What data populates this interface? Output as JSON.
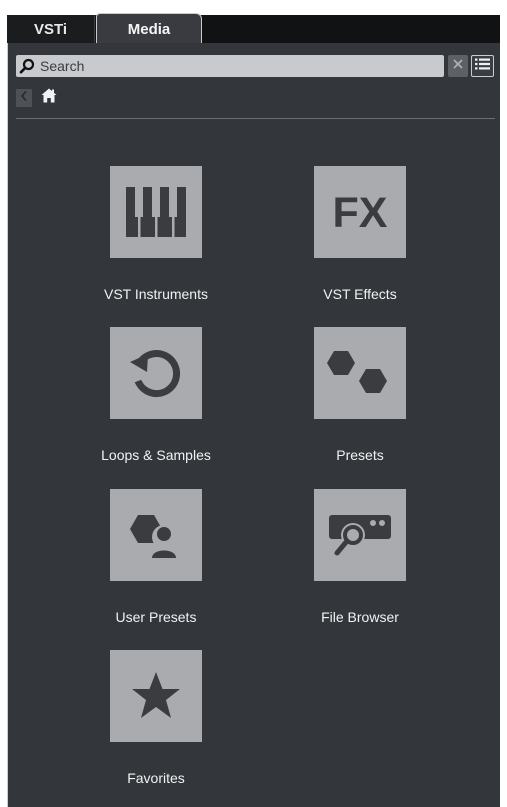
{
  "tabs": [
    {
      "label": "VSTi",
      "active": false
    },
    {
      "label": "Media",
      "active": true
    }
  ],
  "search": {
    "placeholder": "Search",
    "value": "",
    "search_icon": "magnifier-icon",
    "clear_icon": "close-icon",
    "view_icon": "list-view-icon"
  },
  "nav": {
    "back_icon": "chevron-left-icon",
    "home_icon": "home-icon"
  },
  "tiles": [
    {
      "label": "VST Instruments",
      "icon": "piano-keys-icon"
    },
    {
      "label": "VST Effects",
      "icon": "fx-icon",
      "icon_text": "FX"
    },
    {
      "label": "Loops & Samples",
      "icon": "loop-icon"
    },
    {
      "label": "Presets",
      "icon": "hexagons-icon"
    },
    {
      "label": "User Presets",
      "icon": "user-preset-icon"
    },
    {
      "label": "File Browser",
      "icon": "file-browser-icon"
    },
    {
      "label": "Favorites",
      "icon": "star-icon"
    }
  ],
  "colors": {
    "panel_bg": "#33363a",
    "tile_bg": "#a9abae",
    "glyph": "#3a3c40",
    "text": "#f1f2f3"
  }
}
